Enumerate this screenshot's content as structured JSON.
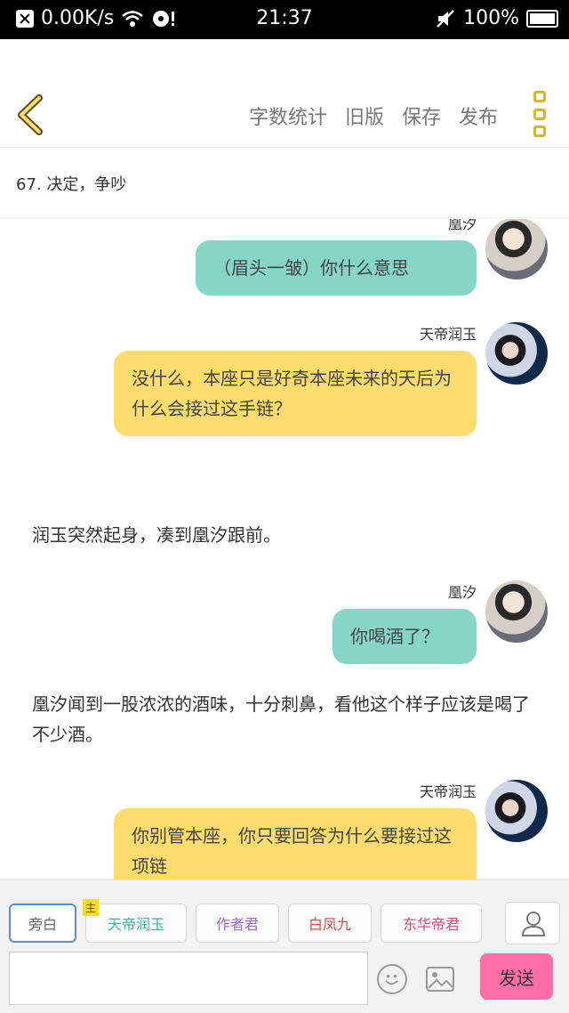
{
  "status_bar": {
    "speed": "0.00K/s",
    "time": "21:37",
    "battery": "100%"
  },
  "toolbar": {
    "word_count": "字数统计",
    "old_version": "旧版",
    "save": "保存",
    "publish": "发布"
  },
  "chapter": {
    "title": "67. 决定，争吵"
  },
  "messages": [
    {
      "speaker": "凰汐",
      "text": "（眉头一皱）你什么意思",
      "color": "#86d6c7"
    },
    {
      "speaker": "天帝润玉",
      "text": "没什么，本座只是好奇本座未来的天后为什么会接过这手链？",
      "color": "#ffdc6e"
    },
    {
      "narration": "润玉突然起身，凑到凰汐跟前。"
    },
    {
      "speaker": "凰汐",
      "text": "你喝酒了？",
      "color": "#86d6c7"
    },
    {
      "narration": "凰汐闻到一股浓浓的酒味，十分刺鼻，看他这个样子应该是喝了不少酒。"
    },
    {
      "speaker": "天帝润玉",
      "text": "你别管本座，你只要回答为什么要接过这项链",
      "color": "#ffdc6e"
    }
  ],
  "roles": {
    "narrator": "旁白",
    "main_tag": "主",
    "r1": {
      "label": "天帝润玉",
      "color": "#3db5a3"
    },
    "r2": {
      "label": "作者君",
      "color": "#a06cc8"
    },
    "r3": {
      "label": "白凤九",
      "color": "#d94a4a"
    },
    "r4": {
      "label": "东华帝君",
      "color": "#e0457a"
    }
  },
  "composer": {
    "input_value": "",
    "send": "发送"
  }
}
